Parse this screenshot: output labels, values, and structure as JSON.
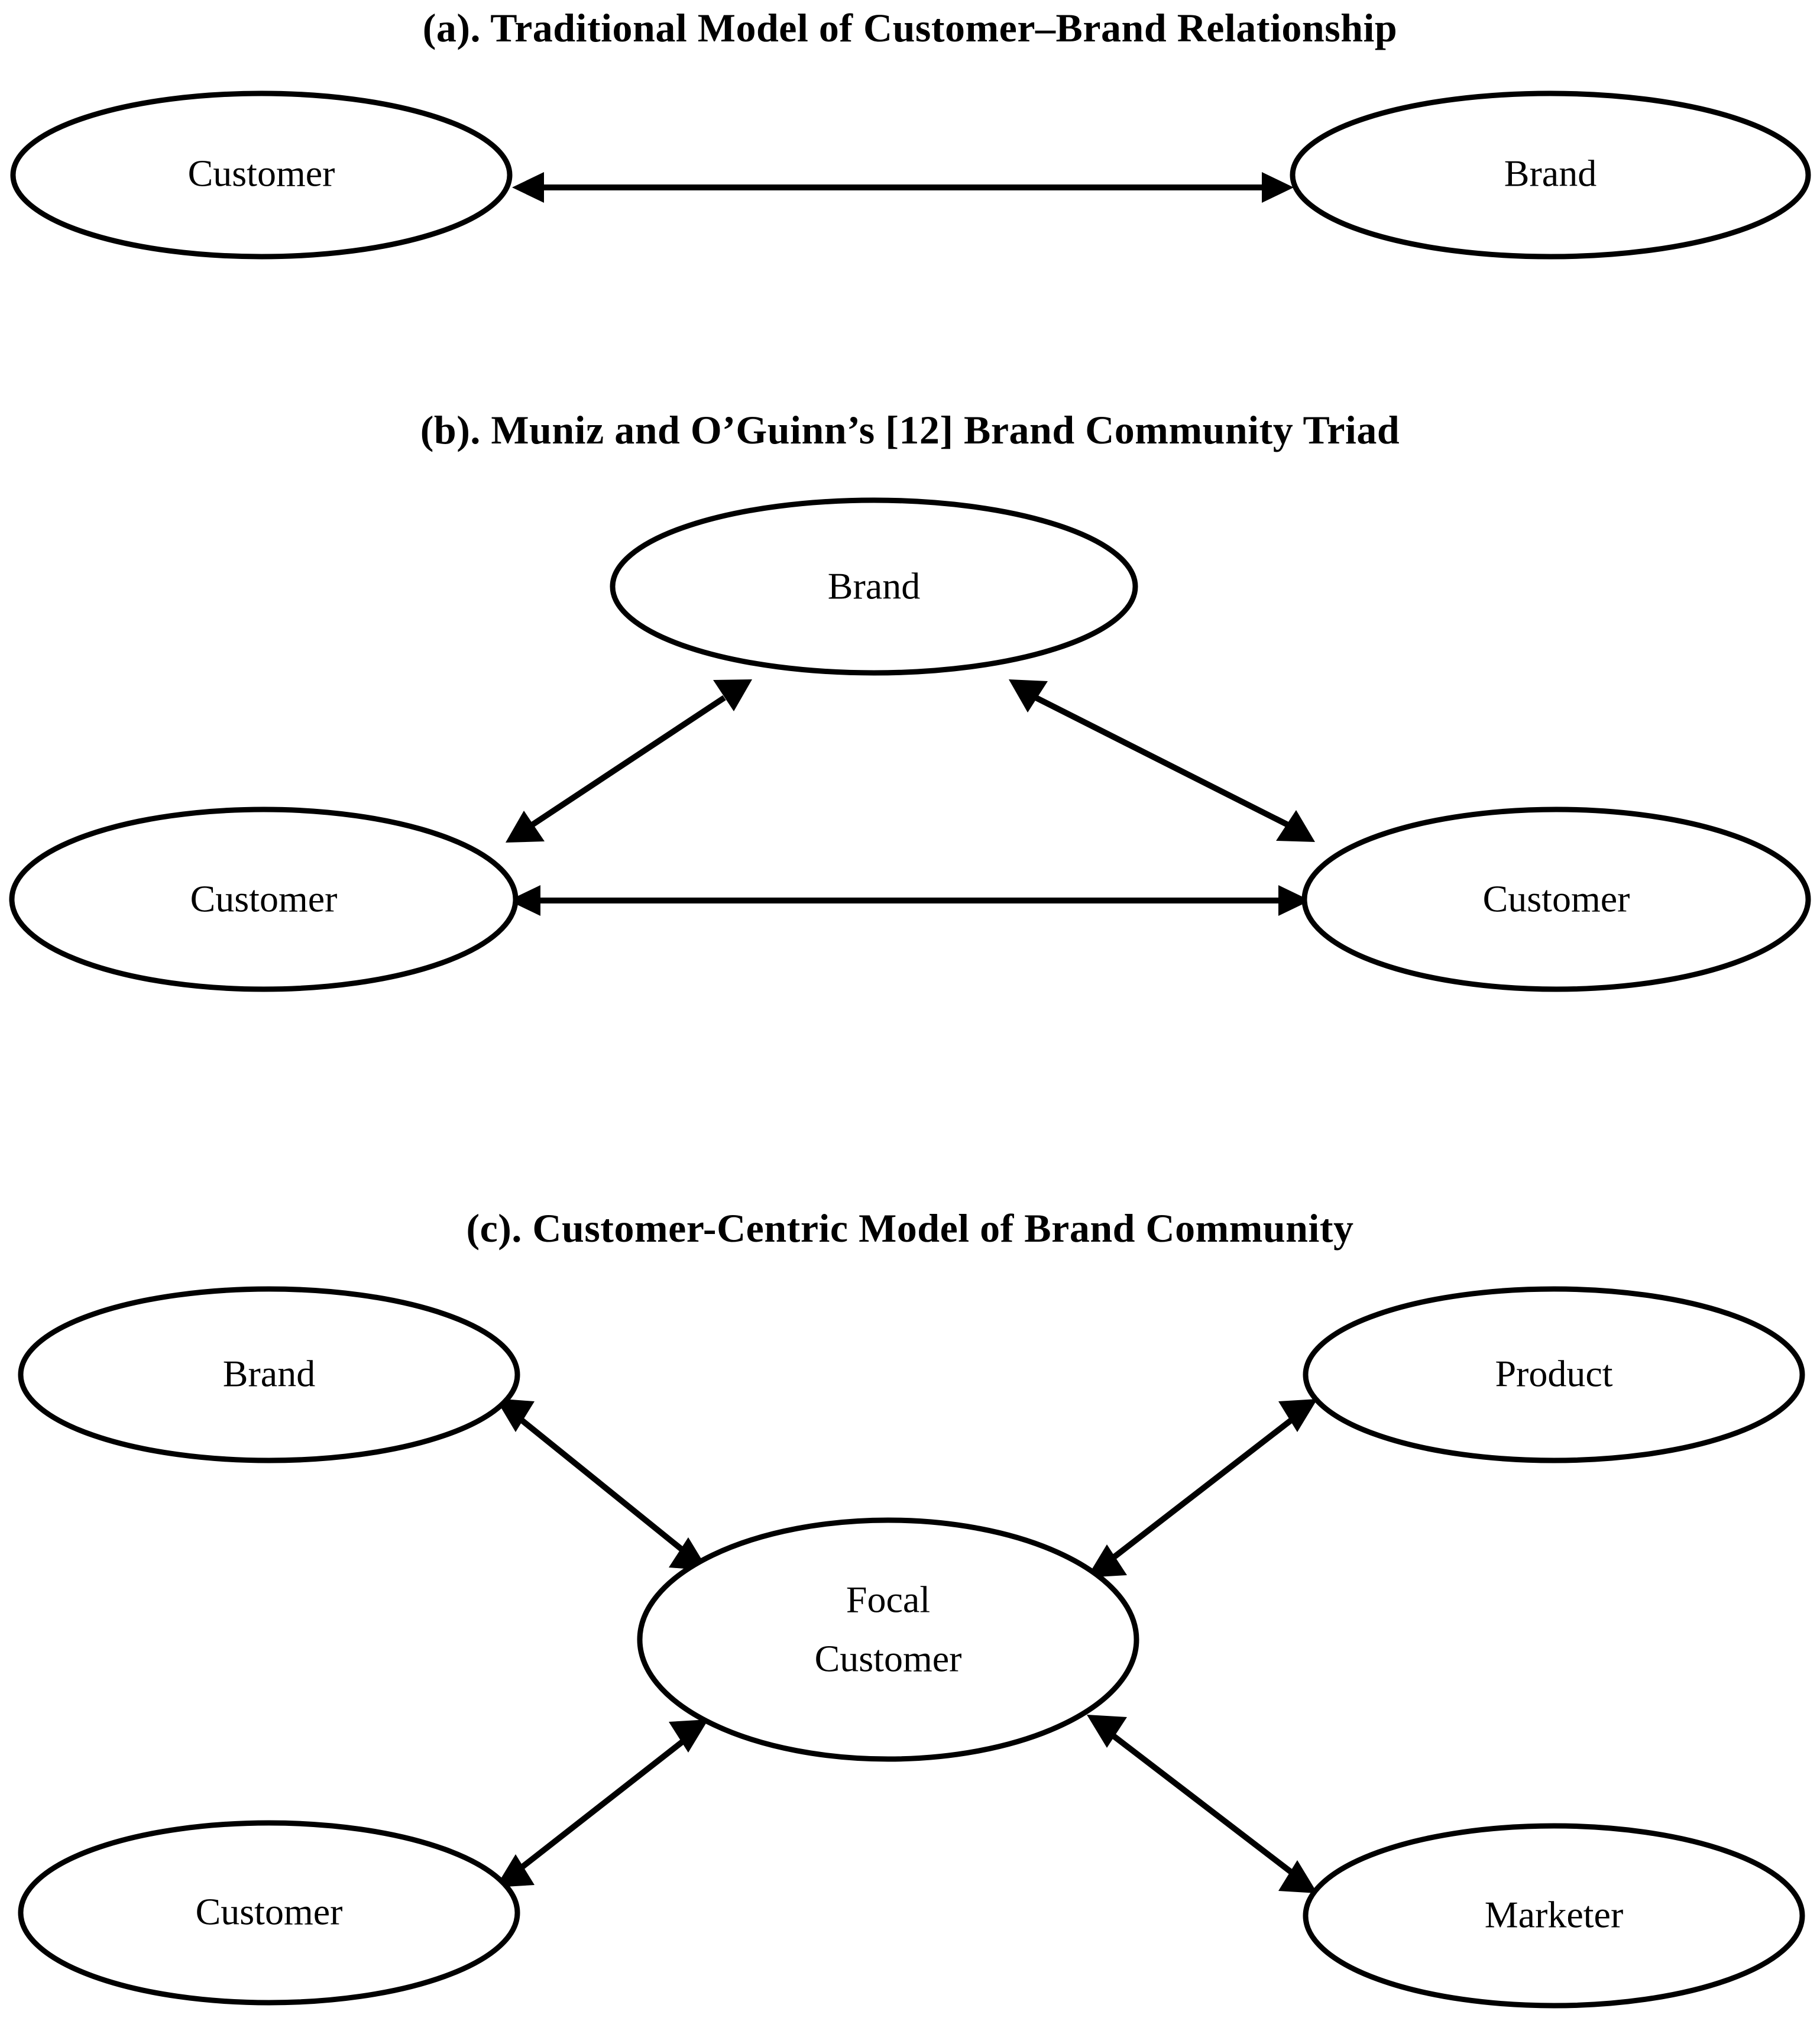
{
  "figure": {
    "background_color": "#ffffff",
    "line_color": "#000000",
    "text_color": "#000000"
  },
  "panels": {
    "a": {
      "title": "(a). Traditional Model of Customer–Brand Relationship",
      "nodes": {
        "left": "Customer",
        "right": "Brand"
      },
      "connections": [
        {
          "from": "Customer",
          "to": "Brand",
          "style": "double-headed-arrow"
        }
      ]
    },
    "b": {
      "title": "(b). Muniz and O’Guinn’s [12] Brand Community Triad",
      "nodes": {
        "top": "Brand",
        "left": "Customer",
        "right": "Customer"
      },
      "connections": [
        {
          "from": "Customer (left)",
          "to": "Brand",
          "style": "double-headed-arrow"
        },
        {
          "from": "Customer (right)",
          "to": "Brand",
          "style": "double-headed-arrow"
        },
        {
          "from": "Customer (left)",
          "to": "Customer (right)",
          "style": "double-headed-arrow"
        }
      ]
    },
    "c": {
      "title": "(c). Customer-Centric Model of Brand Community",
      "nodes": {
        "center_line1": "Focal",
        "center_line2": "Customer",
        "top_left": "Brand",
        "top_right": "Product",
        "bottom_left": "Customer",
        "bottom_right": "Marketer"
      },
      "connections": [
        {
          "from": "Focal Customer",
          "to": "Brand",
          "style": "double-headed-arrow"
        },
        {
          "from": "Focal Customer",
          "to": "Product",
          "style": "double-headed-arrow"
        },
        {
          "from": "Focal Customer",
          "to": "Customer",
          "style": "double-headed-arrow"
        },
        {
          "from": "Focal Customer",
          "to": "Marketer",
          "style": "double-headed-arrow"
        }
      ]
    }
  }
}
